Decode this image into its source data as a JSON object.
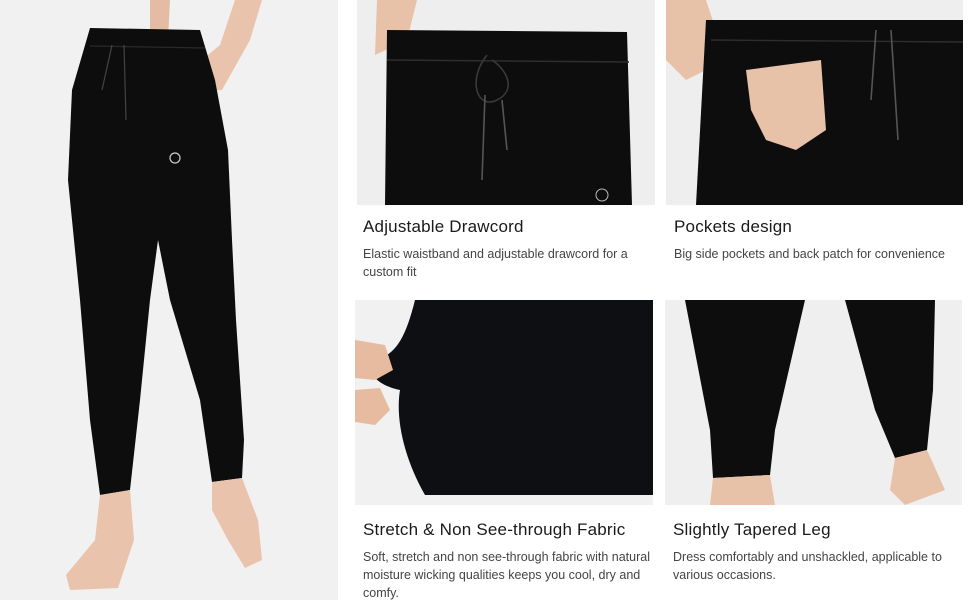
{
  "colors": {
    "background": "#ffffff",
    "photo_background": "#f1f1f1",
    "garment": "#0d0d0e",
    "skin": "#e9c3ab",
    "heading_text": "#1a1a1a",
    "body_text": "#444444"
  },
  "images": {
    "main": "model-wearing-black-jogger-pants",
    "drawcord": "waistband-drawcord-closeup",
    "pockets": "side-pocket-with-hand-closeup",
    "fabric": "fabric-stretch-closeup",
    "leg": "tapered-leg-cuff-closeup"
  },
  "features": [
    {
      "title": "Adjustable Drawcord",
      "description": "Elastic waistband and adjustable drawcord for a custom fit"
    },
    {
      "title": "Pockets design",
      "description": "Big side pockets and back patch for convenience"
    },
    {
      "title": "Stretch & Non See-through Fabric",
      "description": "Soft, stretch and non see-through fabric with natural moisture wicking qualities keeps you cool, dry and comfy."
    },
    {
      "title": "Slightly Tapered Leg",
      "description": "Dress comfortably and unshackled, applicable to various occasions."
    }
  ]
}
